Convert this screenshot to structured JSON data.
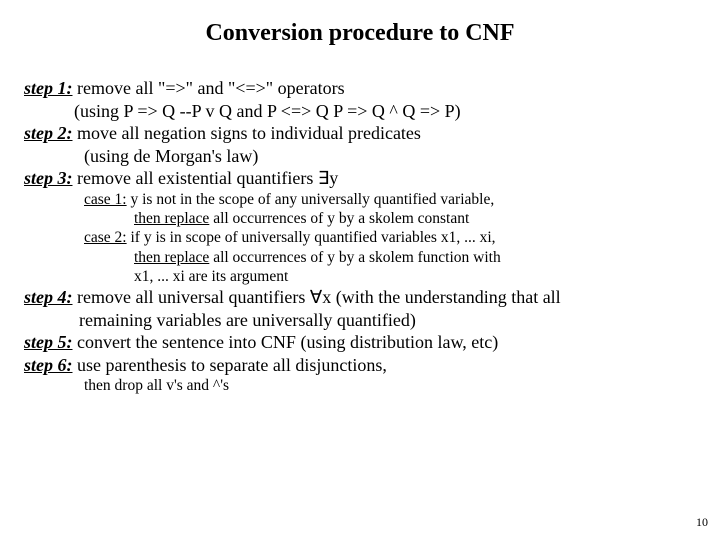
{
  "title": "Conversion procedure to CNF",
  "steps": {
    "s1": {
      "label": "step 1:",
      "text": " remove all \"=>\" and \"<=>\" operators"
    },
    "s1_sub": "(using P => Q  --P v Q and P <=> Q   P => Q ^ Q => P)",
    "s2": {
      "label": "step 2:",
      "text": " move all negation signs to individual predicates"
    },
    "s2_sub": "(using de Morgan's law)",
    "s3": {
      "label": "step 3:",
      "text": " remove all existential quantifiers ∃y"
    },
    "s3_c1_a": "case 1: y is not in the scope of any universally quantified variable,",
    "s3_c1_b_u": "then replace",
    "s3_c1_b_rest": " all occurrences of y by a skolem constant",
    "s3_c2_a": "case 2: if y is in scope of universally quantified variables x1, ... xi,",
    "s3_c2_b_u": "then replace",
    "s3_c2_b_rest": " all occurrences of y by a skolem function with",
    "s3_c2_c": "x1, ... xi  are its argument",
    "s4": {
      "label": "step 4:",
      "text": " remove all universal quantifiers ∀x (with the understanding that  all"
    },
    "s4_cont": "remaining variables are universally quantified)",
    "s5": {
      "label": "step 5:",
      "text": " convert the sentence into CNF (using distribution law, etc)"
    },
    "s6": {
      "label": "step 6:",
      "text": " use parenthesis to separate all disjunctions,"
    },
    "s6_sub": "then drop all v's and ^'s",
    "page": "10"
  }
}
